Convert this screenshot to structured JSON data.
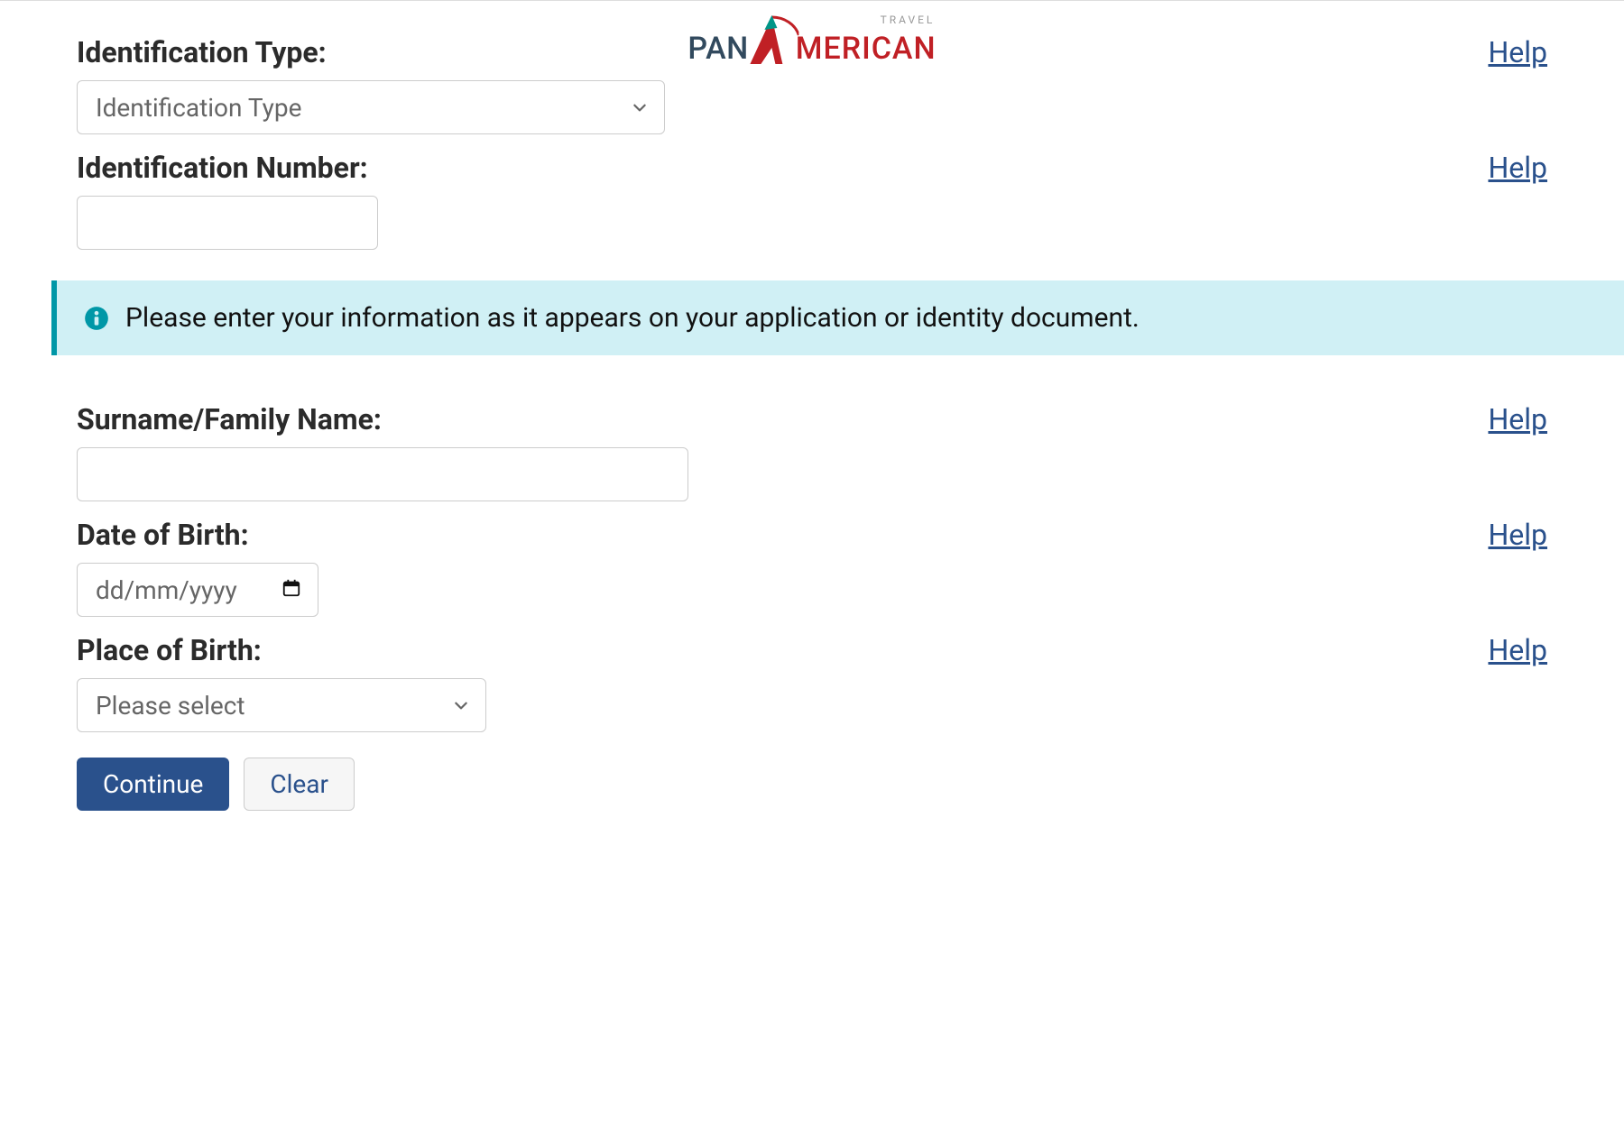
{
  "logo": {
    "left": "PAN",
    "right": "MERICAN",
    "tag": "TRAVEL"
  },
  "fields": {
    "id_type": {
      "label": "Identification Type:",
      "placeholder": "Identification Type",
      "help": "Help"
    },
    "id_num": {
      "label": "Identification Number:",
      "help": "Help"
    },
    "surname": {
      "label": "Surname/Family Name:",
      "help": "Help"
    },
    "dob": {
      "label": "Date of Birth:",
      "placeholder": "dd/mm/yyyy",
      "help": "Help"
    },
    "pob": {
      "label": "Place of Birth:",
      "placeholder": "Please select",
      "help": "Help"
    }
  },
  "info": "Please enter your information as it appears on your application or identity document.",
  "buttons": {
    "continue": "Continue",
    "clear": "Clear"
  }
}
